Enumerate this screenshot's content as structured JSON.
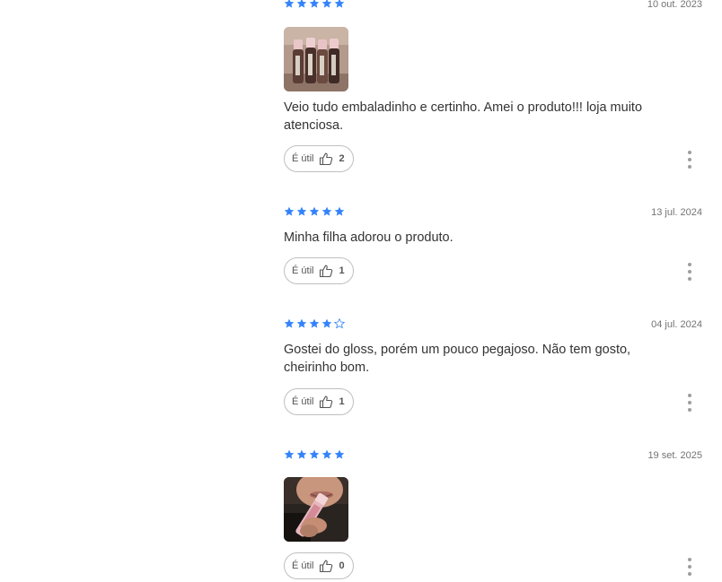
{
  "colors": {
    "star_filled": "#3483fa",
    "star_empty": "#3483fa",
    "text": "#333333",
    "date": "#737373"
  },
  "reviews": [
    {
      "rating": 5,
      "date": "10 out. 2023",
      "has_photo": true,
      "photo_desc": "lip-gloss-tubes-photo",
      "text": "Veio tudo embaladinho e certinho. Amei o produto!!! loja muito atenciosa.",
      "helpful_label": "É útil",
      "helpful_count": "2"
    },
    {
      "rating": 5,
      "date": "13 jul. 2024",
      "has_photo": false,
      "text": "Minha filha adorou o produto.",
      "helpful_label": "É útil",
      "helpful_count": "1"
    },
    {
      "rating": 4,
      "date": "04 jul. 2024",
      "has_photo": false,
      "text": "Gostei do gloss, porém um pouco pegajoso. Não tem gosto, cheirinho bom.",
      "helpful_label": "É útil",
      "helpful_count": "1"
    },
    {
      "rating": 5,
      "date": "19 set. 2025",
      "has_photo": true,
      "photo_desc": "person-holding-gloss-photo",
      "text": "",
      "helpful_label": "É útil",
      "helpful_count": "0"
    }
  ]
}
